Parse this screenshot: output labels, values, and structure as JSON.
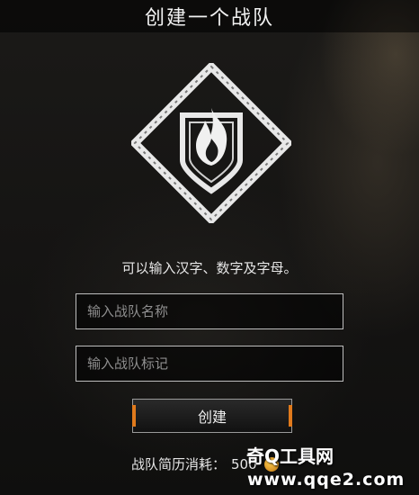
{
  "header": {
    "title": "创建一个战队"
  },
  "emblem": {
    "icon": "flame-shield-icon"
  },
  "form": {
    "hint": "可以输入汉字、数字及字母。",
    "name_placeholder": "输入战队名称",
    "tag_placeholder": "输入战队标记",
    "create_label": "创建"
  },
  "cost": {
    "label": "战队简历消耗：",
    "value": "500",
    "currency_icon": "coin-icon"
  },
  "watermark": {
    "name": "奇Q工具网",
    "url": "www.qqe2.com"
  },
  "colors": {
    "accent": "#e07a1c",
    "border": "#bdbdbd"
  }
}
